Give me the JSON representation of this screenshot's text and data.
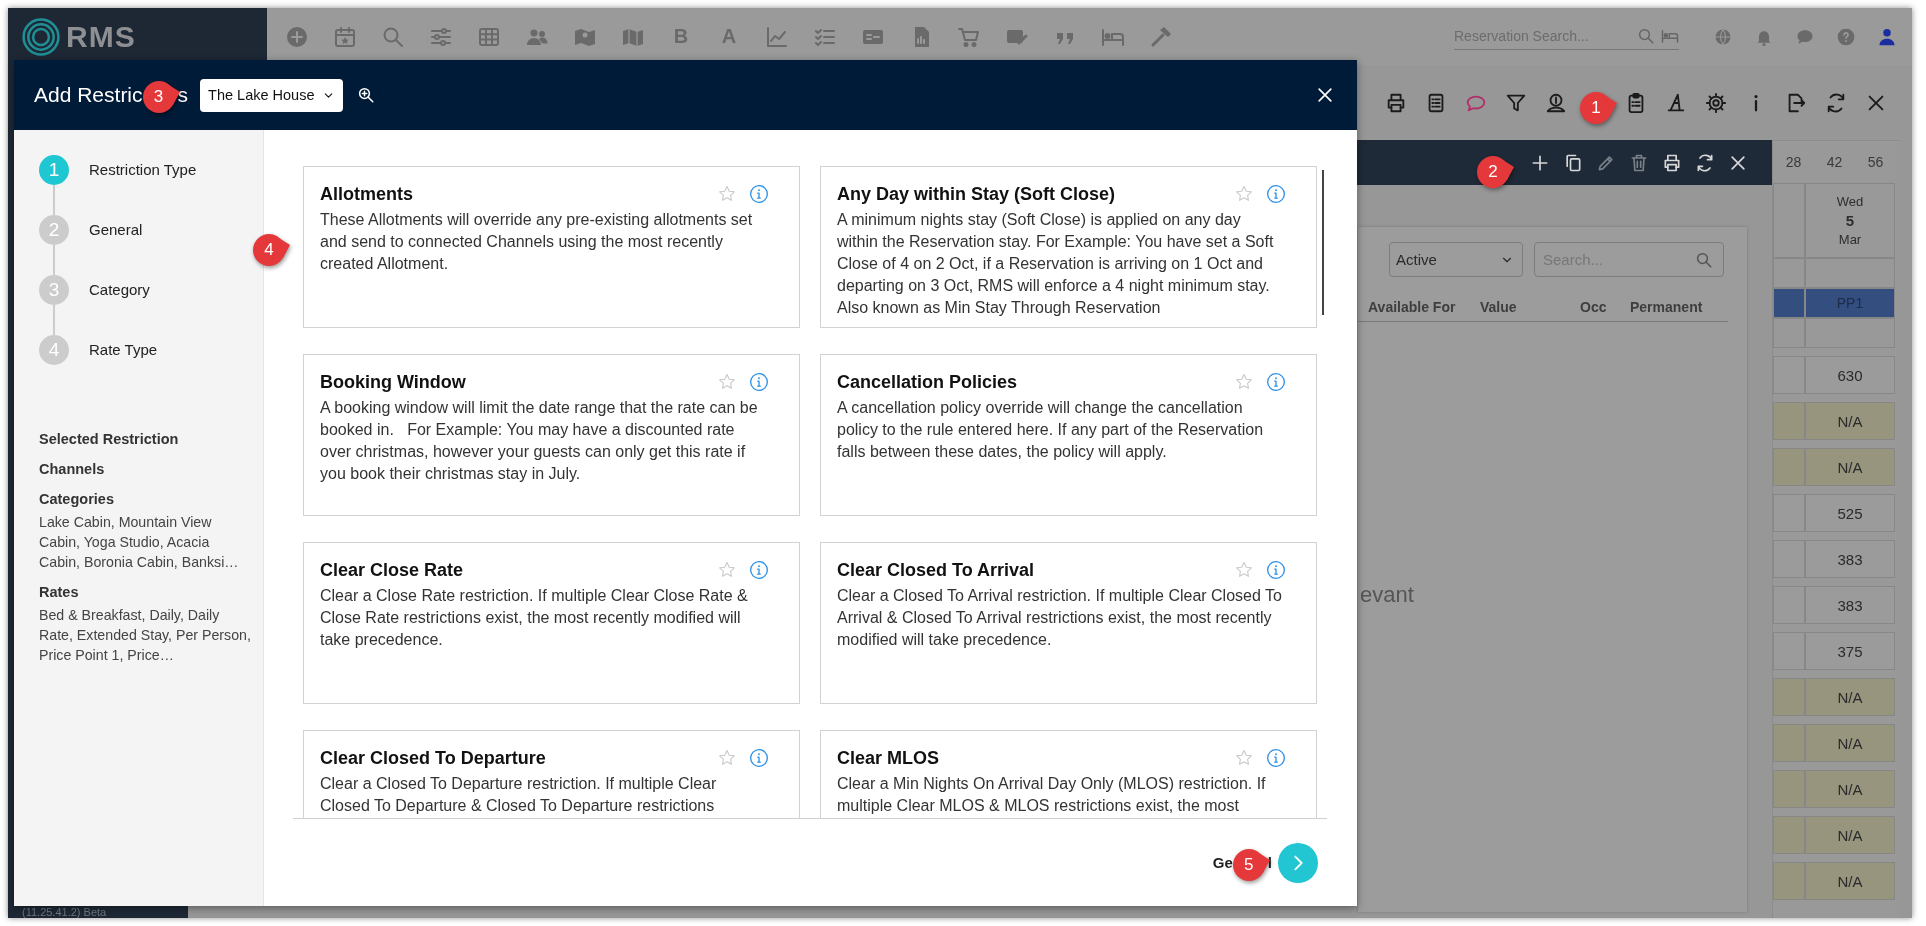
{
  "nav": {
    "logo_text": "RMS",
    "letters": [
      "B",
      "A"
    ],
    "search_placeholder": "Reservation Search..."
  },
  "version": "(11.25.41.2) Beta",
  "panel": {
    "status_select": "Active",
    "search_placeholder": "Search...",
    "columns": [
      "Available For",
      "Value",
      "Occ",
      "Permanent"
    ],
    "empty_message": "evant"
  },
  "calendar": {
    "ticks": [
      "28",
      "42",
      "56"
    ],
    "weekday": "Wed",
    "date": "5",
    "month": "Mar",
    "rate_code": "PP1",
    "cells": [
      {
        "value": "630",
        "kind": "rate"
      },
      {
        "value": "N/A",
        "kind": "na"
      },
      {
        "value": "N/A",
        "kind": "na"
      },
      {
        "value": "525",
        "kind": "rate"
      },
      {
        "value": "383",
        "kind": "rate"
      },
      {
        "value": "383",
        "kind": "rate"
      },
      {
        "value": "375",
        "kind": "rate"
      },
      {
        "value": "N/A",
        "kind": "na"
      },
      {
        "value": "N/A",
        "kind": "na"
      },
      {
        "value": "N/A",
        "kind": "na"
      },
      {
        "value": "N/A",
        "kind": "na"
      },
      {
        "value": "N/A",
        "kind": "na"
      }
    ]
  },
  "modal": {
    "title_parts": [
      "Add Restric",
      "s"
    ],
    "property_select": "The Lake House",
    "steps": [
      {
        "number": "1",
        "label": "Restriction Type",
        "selected": true
      },
      {
        "number": "2",
        "label": "General",
        "selected": false
      },
      {
        "number": "3",
        "label": "Category",
        "selected": false
      },
      {
        "number": "4",
        "label": "Rate Type",
        "selected": false
      }
    ],
    "summary": [
      {
        "heading": "Selected Restriction"
      },
      {
        "heading": "Channels"
      },
      {
        "heading": "Categories",
        "text": "Lake Cabin, Mountain View Cabin, Yoga Studio, Acacia Cabin, Boronia Cabin, Banksi…"
      },
      {
        "heading": "Rates",
        "text": "Bed & Breakfast, Daily, Daily Rate, Extended Stay, Per Person, Price Point 1, Price…"
      }
    ],
    "cards": [
      {
        "title": "Allotments",
        "description": "These Allotments will override any pre-existing allotments set and send to connected Channels using the most recently created Allotment."
      },
      {
        "title": "Any Day within Stay (Soft Close)",
        "description": "A minimum nights stay (Soft Close) is applied on any day within the Reservation stay. For Example: You have set a Soft Close of 4 on 2 Oct, if a Reservation is arriving on 1 Oct and departing on 3 Oct, RMS will enforce a 4 night minimum stay. Also known as Min Stay Through Reservation"
      },
      {
        "title": "Booking Window",
        "description": "A booking window will limit the date range that the rate can be booked in.   For Example: You may have a discounted rate over christmas, however your guests can only get this rate if you book their christmas stay in July."
      },
      {
        "title": "Cancellation Policies",
        "description": "A cancellation policy override will change the cancellation policy to the rule entered here. If any part of the Reservation falls between these dates, the policy will apply."
      },
      {
        "title": "Clear Close Rate",
        "description": "Clear a Close Rate restriction. If multiple Clear Close Rate & Close Rate restrictions exist, the most recently modified will take precedence."
      },
      {
        "title": "Clear Closed To Arrival",
        "description": "Clear a Closed To Arrival restriction. If multiple Clear Closed To Arrival & Closed To Arrival restrictions exist, the most recently modified will take precedence."
      },
      {
        "title": "Clear Closed To Departure",
        "description": "Clear a Closed To Departure restriction. If multiple Clear Closed To Departure & Closed To Departure restrictions"
      },
      {
        "title": "Clear MLOS",
        "description": "Clear a Min Nights On Arrival Day Only (MLOS) restriction. If multiple Clear MLOS & MLOS restrictions exist, the most"
      }
    ],
    "next_label_parts": [
      "Ge",
      "l"
    ]
  },
  "callouts": [
    "1",
    "2",
    "3",
    "4",
    "5"
  ]
}
